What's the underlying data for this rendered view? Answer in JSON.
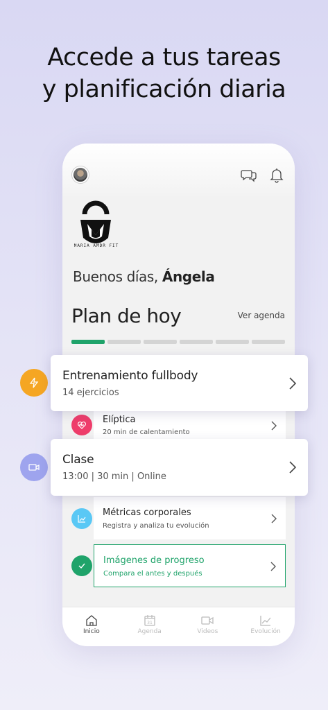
{
  "headline": {
    "line1": "Accede a tus tareas",
    "line2": "y planificación diaria"
  },
  "phone": {
    "logo_text": "MARIA AMDR FIT",
    "greeting_prefix": "Buenos días,",
    "greeting_name": "Ángela",
    "plan_title": "Plan de hoy",
    "ver_agenda": "Ver agenda",
    "progress": {
      "completed": 1,
      "total": 6
    }
  },
  "cards": [
    {
      "title": "Entrenamiento fullbody",
      "subtitle": "14 ejercicios",
      "icon": "lightning-icon",
      "color": "#f5a623"
    },
    {
      "title": "Clase",
      "subtitle": "13:00 | 30 min | Online",
      "icon": "video-camera-icon",
      "color": "#9ea4ee"
    }
  ],
  "rows": [
    {
      "title": "Elíptica",
      "subtitle": "20 min de calentamiento",
      "icon": "heart-icon",
      "color": "#ef3d6b"
    },
    {
      "title": "Métricas corporales",
      "subtitle": "Registra y analiza tu evolución",
      "icon": "chart-icon",
      "color": "#5ac8f5"
    },
    {
      "title": "Imágenes de progreso",
      "subtitle": "Compara el antes y después",
      "icon": "check-icon",
      "color": "#1fa36a",
      "completed": true
    }
  ],
  "tabs": [
    {
      "label": "Inicio",
      "icon": "home-icon",
      "active": true
    },
    {
      "label": "Agenda",
      "icon": "calendar-icon",
      "calendar_day": "31",
      "active": false
    },
    {
      "label": "Videos",
      "icon": "video-icon",
      "active": false
    },
    {
      "label": "Evolución",
      "icon": "trend-icon",
      "active": false
    }
  ]
}
